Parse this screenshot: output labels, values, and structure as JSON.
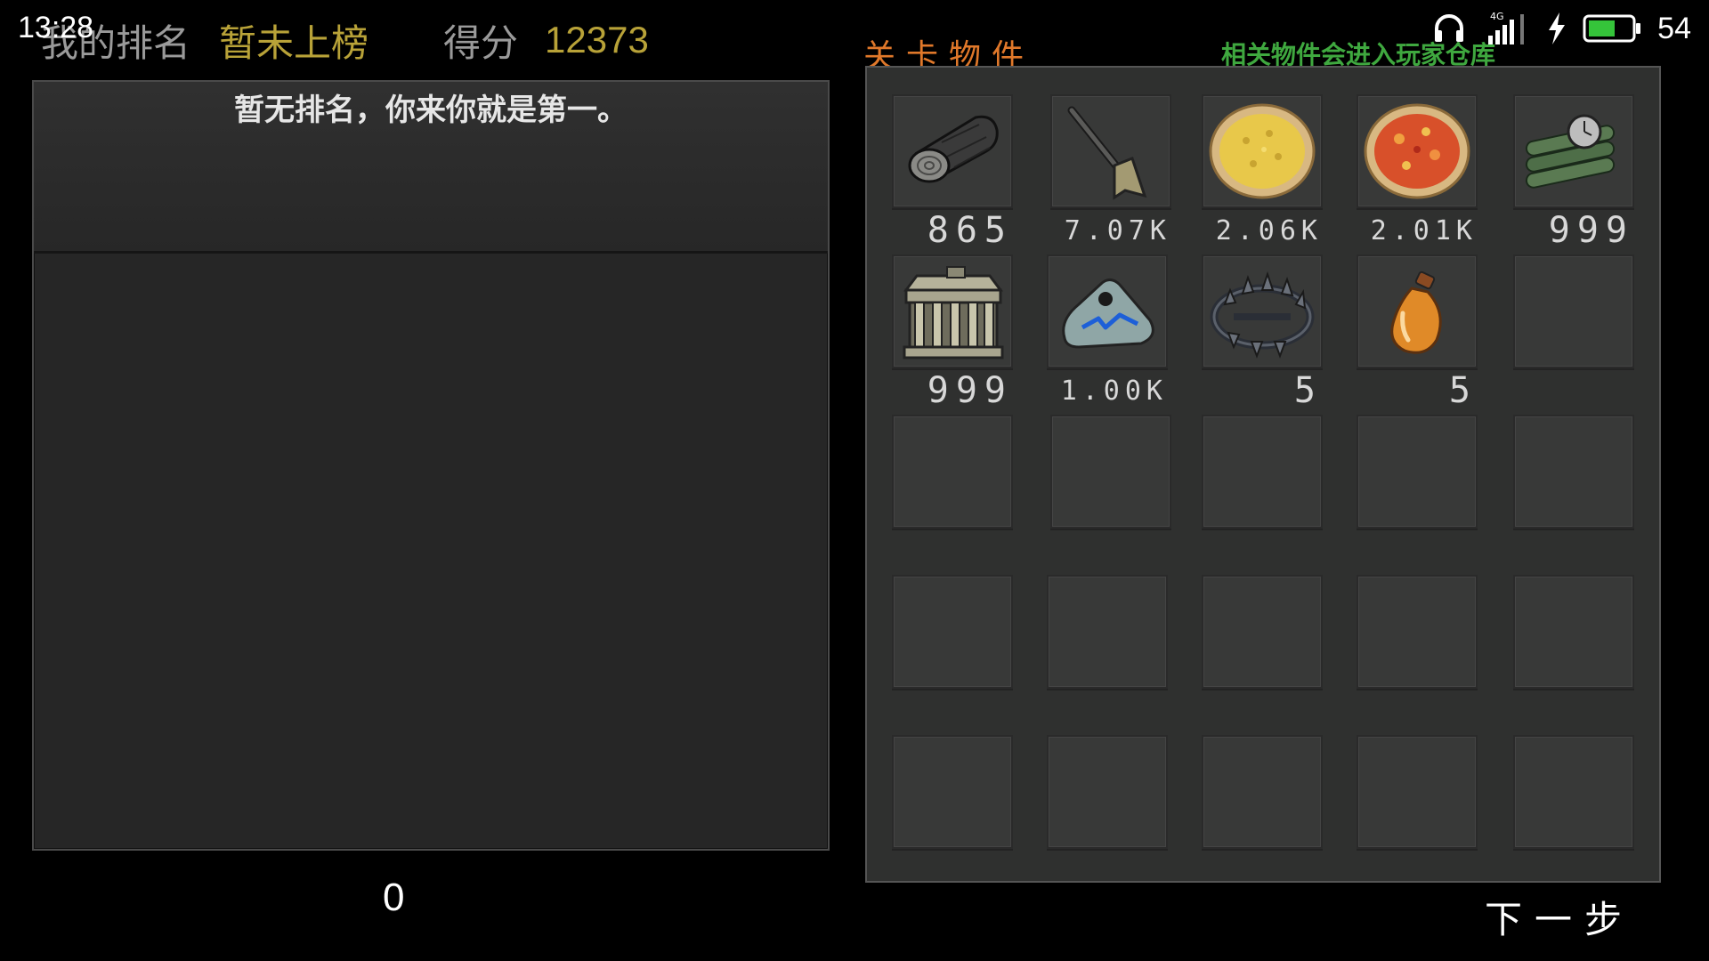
{
  "status_bar": {
    "time": "13:28",
    "network": "4G",
    "battery": "54"
  },
  "header": {
    "rank_label": "我的排名",
    "rank_value": "暂未上榜",
    "score_label": "得分",
    "score_value": "12373"
  },
  "leaderboard": {
    "empty_message": "暂无排名，你来你就是第一。",
    "count": "0"
  },
  "items": {
    "title": "关卡物件",
    "hint": "相关物件会进入玩家仓库",
    "slots": [
      {
        "icon": "log-icon",
        "qty": "865"
      },
      {
        "icon": "shovel-icon",
        "qty": "7.07K"
      },
      {
        "icon": "cheese-pizza-icon",
        "qty": "2.06K"
      },
      {
        "icon": "tomato-pizza-icon",
        "qty": "2.01K"
      },
      {
        "icon": "dynamite-timer-icon",
        "qty": "999"
      },
      {
        "icon": "stone-cage-icon",
        "qty": "999"
      },
      {
        "icon": "rune-stone-icon",
        "qty": "1.00K"
      },
      {
        "icon": "bear-trap-icon",
        "qty": "5"
      },
      {
        "icon": "potion-bottle-icon",
        "qty": "5"
      },
      {
        "icon": "",
        "qty": ""
      }
    ]
  },
  "footer": {
    "next_label": "下一步"
  }
}
